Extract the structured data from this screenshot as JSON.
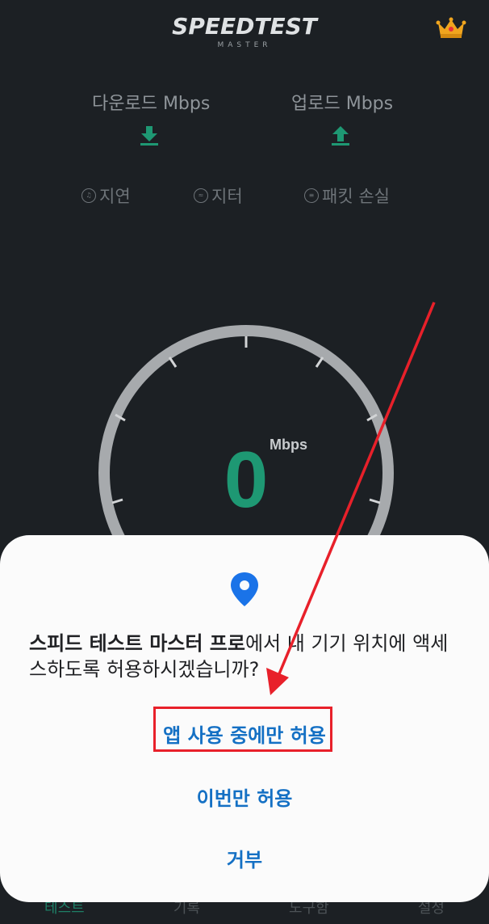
{
  "app": {
    "logo_text": "SPEEDTEST",
    "logo_subtext": "MASTER",
    "premium_icon": "crown-icon"
  },
  "metrics": {
    "download_label": "다운로드 Mbps",
    "upload_label": "업로드 Mbps",
    "download_icon": "download-icon",
    "upload_icon": "upload-icon"
  },
  "stats": {
    "latency_label": "지연",
    "jitter_label": "지터",
    "packet_loss_label": "패킷 손실"
  },
  "gauge": {
    "value": "0",
    "unit": "Mbps"
  },
  "bottom_nav": {
    "items": [
      {
        "label": "테스트"
      },
      {
        "label": "기록"
      },
      {
        "label": "도구함"
      },
      {
        "label": "설정"
      }
    ]
  },
  "dialog": {
    "icon": "location-pin-icon",
    "message_app_name": "스피드 테스트 마스터 프로",
    "message_rest": "에서 내 기기 위치에 액세스하도록 허용하시겠습니까?",
    "option_while_using": "앱 사용 중에만 허용",
    "option_only_this_time": "이번만 허용",
    "option_deny": "거부"
  },
  "colors": {
    "background": "#1c2024",
    "accent_green": "#1e9873",
    "dialog_bg": "#fbfbfb",
    "dialog_button_text": "#1470c4",
    "annotation_red": "#e8202a"
  }
}
